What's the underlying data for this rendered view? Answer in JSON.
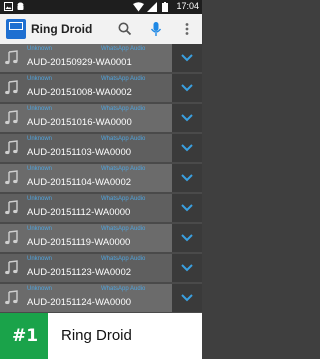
{
  "status_bar": {
    "time": "17:04"
  },
  "app_bar": {
    "title": "Ring Droid"
  },
  "list": {
    "items": [
      {
        "meta_left": "Unknown",
        "meta_right": "WhatsApp Audio",
        "name": "AUD-20150929-WA0001"
      },
      {
        "meta_left": "Unknown",
        "meta_right": "WhatsApp Audio",
        "name": "AUD-20151008-WA0002"
      },
      {
        "meta_left": "Unknown",
        "meta_right": "WhatsApp Audio",
        "name": "AUD-20151016-WA0000"
      },
      {
        "meta_left": "Unknown",
        "meta_right": "WhatsApp Audio",
        "name": "AUD-20151103-WA0000"
      },
      {
        "meta_left": "Unknown",
        "meta_right": "WhatsApp Audio",
        "name": "AUD-20151104-WA0002"
      },
      {
        "meta_left": "Unknown",
        "meta_right": "WhatsApp Audio",
        "name": "AUD-20151112-WA0000"
      },
      {
        "meta_left": "Unknown",
        "meta_right": "WhatsApp Audio",
        "name": "AUD-20151119-WA0000"
      },
      {
        "meta_left": "Unknown",
        "meta_right": "WhatsApp Audio",
        "name": "AUD-20151123-WA0002"
      },
      {
        "meta_left": "Unknown",
        "meta_right": "WhatsApp Audio",
        "name": "AUD-20151124-WA0000"
      }
    ]
  },
  "banner": {
    "rank": "#1",
    "title": "Ring Droid"
  },
  "colors": {
    "badge_green": "#1aa34a",
    "accent_blue": "#1e6fd1",
    "meta_text": "#4fa3dd"
  },
  "icons": [
    "app-logo-icon",
    "search-icon",
    "microphone-icon",
    "more-vert-icon",
    "music-note-icon",
    "chevron-down-icon"
  ]
}
